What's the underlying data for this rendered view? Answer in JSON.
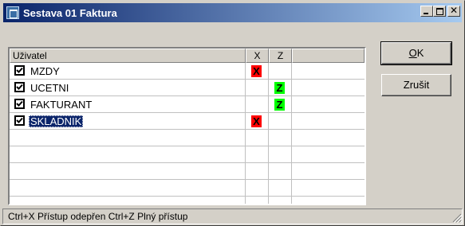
{
  "window": {
    "title": "Sestava 01 Faktura",
    "icon": "report-window-icon",
    "controls": {
      "minimize": "minimize-icon",
      "maximize": "maximize-icon",
      "close": "close-icon"
    }
  },
  "grid": {
    "columns": [
      "Uživatel",
      "X",
      "Z",
      ""
    ],
    "rows": [
      {
        "checked": true,
        "name": "MZDY",
        "x": "X",
        "z": ""
      },
      {
        "checked": true,
        "name": "UCETNI",
        "x": "",
        "z": "Z"
      },
      {
        "checked": true,
        "name": "FAKTURANT",
        "x": "",
        "z": "Z"
      },
      {
        "checked": true,
        "name": "SKLADNIK",
        "x": "X",
        "z": "",
        "selected": true
      }
    ]
  },
  "buttons": {
    "ok_mnemonic": "O",
    "ok_rest": "K",
    "cancel": "Zrušit"
  },
  "status": {
    "text": "Ctrl+X Přístup odepřen  Ctrl+Z Plný přístup"
  },
  "colors": {
    "deny": "#ff0000",
    "allow": "#00ff00",
    "selection": "#0a246a",
    "titlebar": "#0a246a"
  }
}
